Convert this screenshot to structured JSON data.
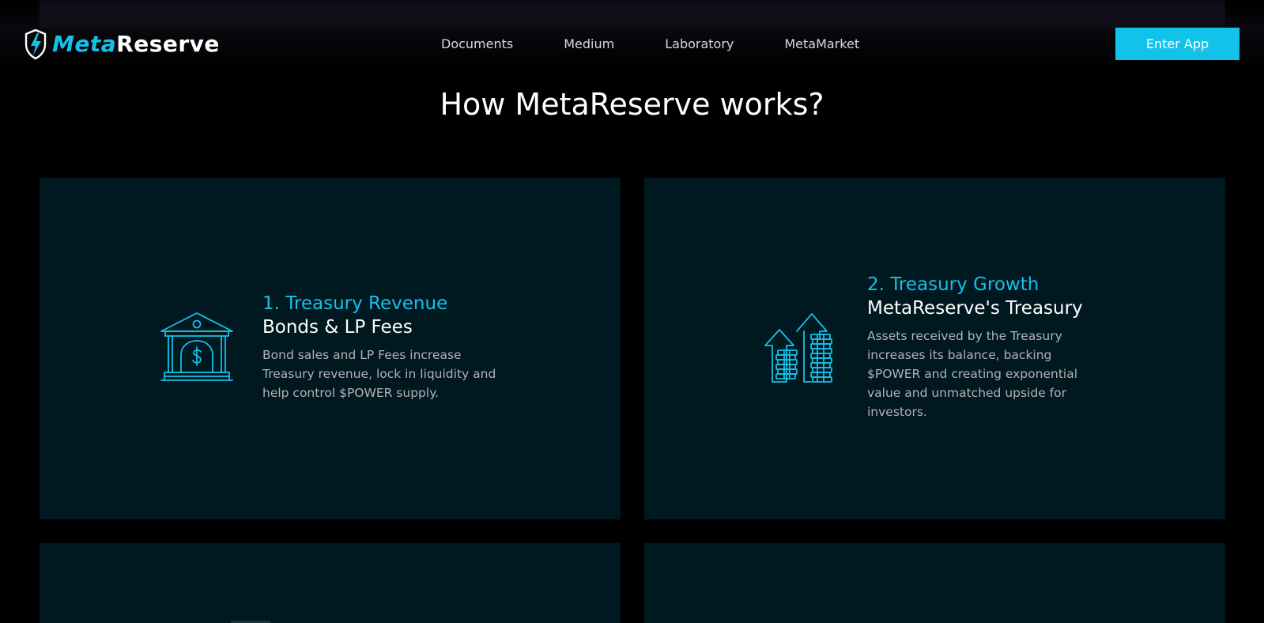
{
  "header": {
    "logo": {
      "meta": "Meta",
      "reserve": "Reserve",
      "icon": "shield-lightning-icon"
    },
    "nav": [
      {
        "label": "Documents"
      },
      {
        "label": "Medium"
      },
      {
        "label": "Laboratory"
      },
      {
        "label": "MetaMarket"
      }
    ],
    "enter_app_label": "Enter App"
  },
  "main": {
    "title": "How MetaReserve works?",
    "cards": [
      {
        "step": "1. Treasury Revenue",
        "heading": "Bonds & LP Fees",
        "body": "Bond sales and LP Fees increase Treasury revenue, lock in liquidity and help control $POWER supply.",
        "icon": "bank-dollar-icon"
      },
      {
        "step": "2. Treasury Growth",
        "heading": "MetaReserve's Treasury",
        "body": "Assets received by the Treasury increases its balance, backing $POWER and creating exponential value and unmatched upside for investors.",
        "icon": "growth-arrows-coins-icon"
      }
    ]
  },
  "colors": {
    "accent": "#13c2e8",
    "background": "#000000",
    "card_background": "#001820",
    "body_text": "#b3b3b3"
  }
}
